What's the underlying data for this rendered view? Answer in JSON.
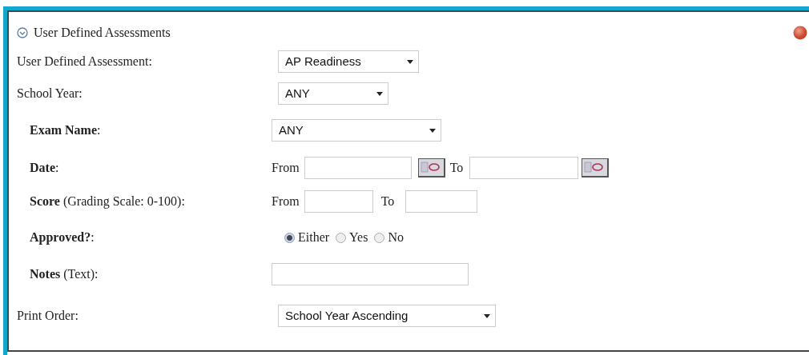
{
  "panel": {
    "title": "User Defined Assessments"
  },
  "fields": [
    {
      "kind": "select",
      "label": "User Defined Assessment:",
      "value": "AP Readiness"
    },
    {
      "kind": "select",
      "label": "School Year:",
      "value": "ANY"
    },
    {
      "kind": "group",
      "children": [
        {
          "kind": "select",
          "label": "**Exam Name**:",
          "value": "ANY"
        },
        {
          "kind": "date_range",
          "label": "**Date**:",
          "from_label": "From",
          "to_label": "To"
        },
        {
          "kind": "number_range",
          "label": "**Score** (Grading Scale: 0-100):",
          "from_label": "From",
          "to_label": "To"
        },
        {
          "kind": "radio",
          "label": "**Approved?**:",
          "options": [
            {
              "label": "Either",
              "selected": true
            },
            {
              "label": "Yes",
              "selected": false
            },
            {
              "label": "No",
              "selected": false
            }
          ]
        },
        {
          "kind": "text",
          "label": "**Notes** (Text):"
        }
      ]
    },
    {
      "kind": "select",
      "label": "Print Order:",
      "value": "School Year Ascending"
    }
  ]
}
